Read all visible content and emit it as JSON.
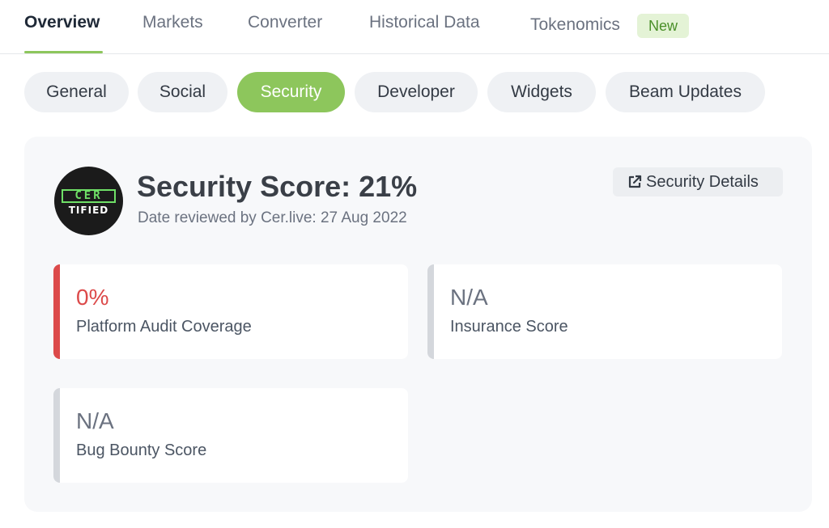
{
  "top_tabs": [
    {
      "label": "Overview",
      "active": true
    },
    {
      "label": "Markets",
      "active": false
    },
    {
      "label": "Converter",
      "active": false
    },
    {
      "label": "Historical Data",
      "active": false
    },
    {
      "label": "Tokenomics",
      "active": false
    }
  ],
  "new_badge": "New",
  "pills": [
    {
      "label": "General",
      "active": false
    },
    {
      "label": "Social",
      "active": false
    },
    {
      "label": "Security",
      "active": true
    },
    {
      "label": "Developer",
      "active": false
    },
    {
      "label": "Widgets",
      "active": false
    },
    {
      "label": "Beam Updates",
      "active": false
    }
  ],
  "security": {
    "logo_top": "CER",
    "logo_bottom": "TIFIED",
    "title": "Security Score: 21%",
    "review": "Date reviewed by Cer.live: 27 Aug 2022",
    "details_button": "Security Details",
    "details_icon": "external-link-icon",
    "cards": [
      {
        "value": "0%",
        "label": "Platform Audit Coverage",
        "bar_color": "#dc4a4a"
      },
      {
        "value": "N/A",
        "label": "Insurance Score",
        "bar_color": "#d4d7dc"
      },
      {
        "value": "N/A",
        "label": "Bug Bounty Score",
        "bar_color": "#d4d7dc"
      }
    ]
  },
  "colors": {
    "accent": "#8dc65c",
    "danger": "#dc4a4a",
    "muted_bar": "#d4d7dc"
  }
}
